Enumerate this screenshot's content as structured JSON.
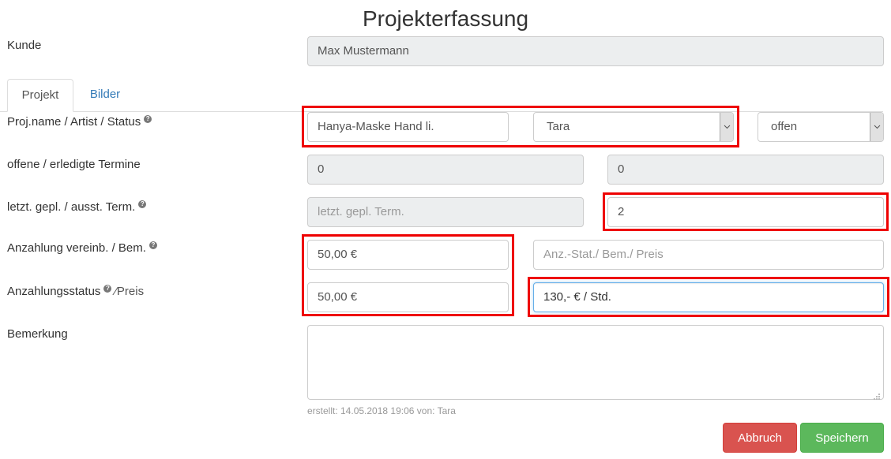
{
  "page": {
    "title": "Projekterfassung"
  },
  "customer": {
    "label": "Kunde",
    "value": "Max Mustermann"
  },
  "tabs": [
    {
      "label": "Projekt",
      "active": true
    },
    {
      "label": "Bilder",
      "active": false
    }
  ],
  "rows": {
    "project": {
      "label": "Proj.name / Artist / Status",
      "name_value": "Hanya-Maske Hand li.",
      "artist_value": "Tara",
      "status_value": "offen"
    },
    "appointments": {
      "label": "offene / erledigte Termine",
      "open_value": "0",
      "done_value": "0"
    },
    "last_term": {
      "label": "letzt. gepl. / ausst. Term.",
      "last_placeholder": "letzt. gepl. Term.",
      "outstanding_value": "2"
    },
    "deposit": {
      "label": "Anzahlung vereinb. / Bem.",
      "agreed_value": "50,00 €",
      "remark_placeholder": "Anz.-Stat./ Bem./ Preis"
    },
    "deposit_status": {
      "label": "Anzahlungsstatus",
      "label_suffix": "⁄Preis",
      "status_value": "50,00 €",
      "price_value": "130,- € / Std."
    },
    "remark": {
      "label": "Bemerkung",
      "value": ""
    }
  },
  "meta": {
    "created": "erstellt: 14.05.2018 19:06 von: Tara"
  },
  "buttons": {
    "cancel": "Abbruch",
    "save": "Speichern"
  },
  "icons": {
    "help": "?"
  },
  "colors": {
    "highlight": "#ee0000",
    "danger": "#d9534f",
    "success": "#5cb85c",
    "link": "#337ab7"
  }
}
